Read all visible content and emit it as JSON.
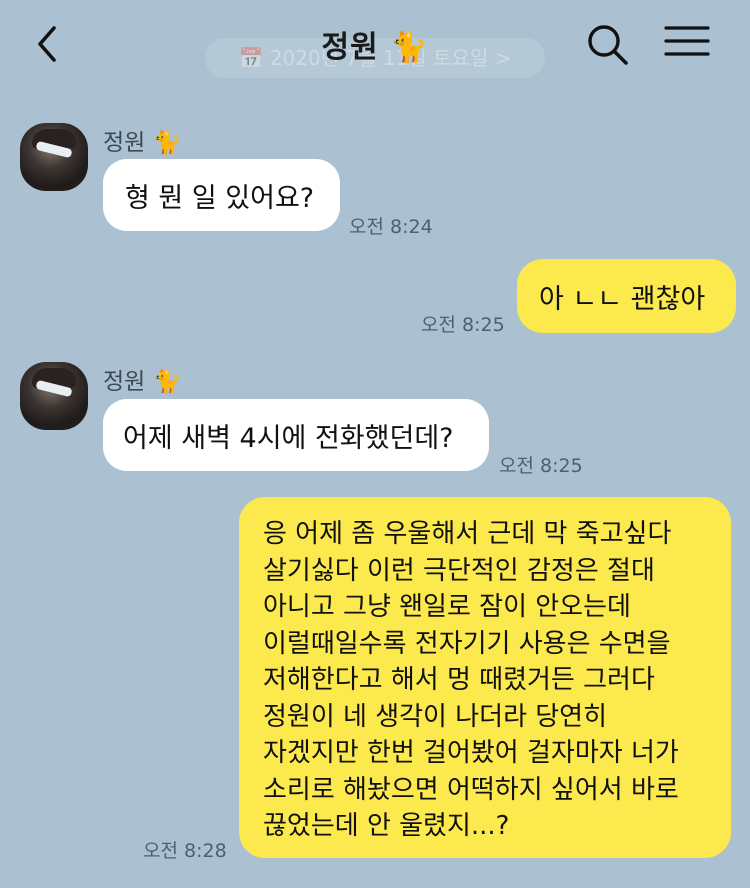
{
  "header": {
    "title": "정원 🐈",
    "date_banner": "📅 2020년 7월 11일 토요일 >",
    "icons": {
      "back": "back-chevron-icon",
      "search": "search-icon",
      "menu": "hamburger-menu-icon"
    }
  },
  "messages": [
    {
      "sender": "정원 🐈",
      "text": "형 뭔 일 있어요?",
      "time": "오전 8:24",
      "direction": "incoming"
    },
    {
      "text": "아 ㄴㄴ 괜찮아",
      "time": "오전 8:25",
      "direction": "outgoing"
    },
    {
      "sender": "정원 🐈",
      "text": "어제 새벽 4시에 전화했던데?",
      "time": "오전 8:25",
      "direction": "incoming"
    },
    {
      "text": "응 어제 좀 우울해서 근데 막 죽고싶다\n살기싫다 이런 극단적인 감정은 절대\n아니고 그냥 왠일로 잠이 안오는데\n이럴때일수록 전자기기 사용은 수면을\n저해한다고 해서 멍 때렸거든 그러다\n정원이 네 생각이 나더라 당연히\n자겠지만 한번 걸어봤어 걸자마자 너가\n소리로 해놨으면 어떡하지 싶어서 바로\n끊었는데 안 울렸지...?",
      "time": "오전 8:28",
      "direction": "outgoing"
    }
  ],
  "colors": {
    "background": "#abc1d1",
    "outgoing_bubble": "#fbe94d",
    "incoming_bubble": "#ffffff"
  }
}
